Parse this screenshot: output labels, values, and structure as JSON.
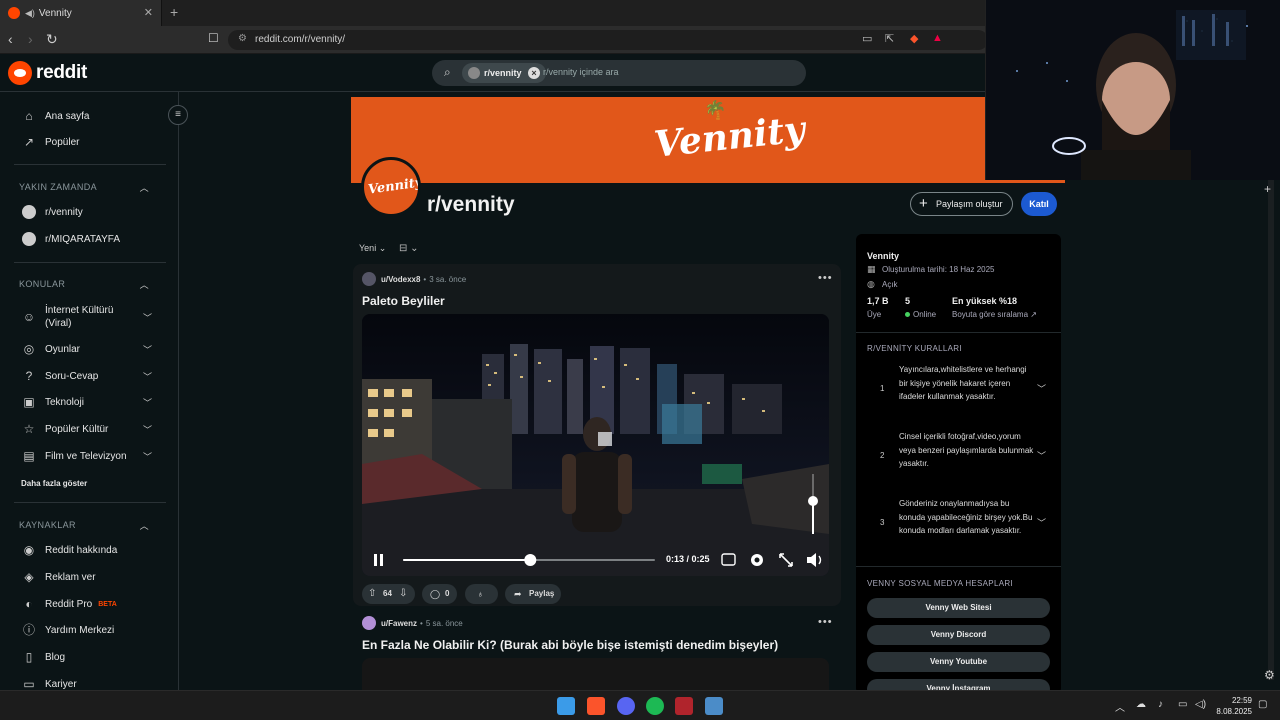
{
  "browser": {
    "tab_title": "Vennity",
    "url": "reddit.com/r/vennity/"
  },
  "header": {
    "logo_text": "reddit",
    "search_chip": "r/vennity",
    "search_placeholder": "r/vennity içinde ara"
  },
  "sidebar": {
    "top_items": [
      {
        "label": "Ana sayfa",
        "icon": "home-icon"
      },
      {
        "label": "Popüler",
        "icon": "popular-icon"
      }
    ],
    "recent_heading": "YAKIN ZAMANDA",
    "recent": [
      "r/vennity",
      "r/MIQARATAYFA"
    ],
    "topics_heading": "KONULAR",
    "topics": [
      {
        "label": "İnternet Kültürü (Viral)",
        "icon": "smile-icon"
      },
      {
        "label": "Oyunlar",
        "icon": "gamepad-icon"
      },
      {
        "label": "Soru-Cevap",
        "icon": "question-icon"
      },
      {
        "label": "Teknoloji",
        "icon": "chip-icon"
      },
      {
        "label": "Popüler Kültür",
        "icon": "star-icon"
      },
      {
        "label": "Film ve Televizyon",
        "icon": "film-icon"
      }
    ],
    "show_more": "Daha fazla göster",
    "resources_heading": "KAYNAKLAR",
    "resources": [
      {
        "label": "Reddit hakkında",
        "icon": "reddit-icon"
      },
      {
        "label": "Reklam ver",
        "icon": "megaphone-icon"
      },
      {
        "label": "Reddit Pro",
        "icon": "pro-icon"
      },
      {
        "label": "Yardım Merkezi",
        "icon": "help-icon"
      },
      {
        "label": "Blog",
        "icon": "book-icon"
      },
      {
        "label": "Kariyer",
        "icon": "briefcase-icon"
      }
    ],
    "beta_badge": "BETA"
  },
  "subreddit": {
    "banner_text": "Vennity",
    "avatar_text": "Vennity",
    "name": "r/vennity",
    "create_post": "Paylaşım oluştur",
    "join": "Katıl",
    "sort": "Yeni"
  },
  "posts": [
    {
      "user": "u/Vodexx8",
      "time": "3 sa. önce",
      "title": "Paleto Beyliler",
      "video_time": "0:13 / 0:25",
      "progress": 0.505,
      "volume": 0.55,
      "votes": "64",
      "comments": "0",
      "share": "Paylaş"
    },
    {
      "user": "u/Fawenz",
      "time": "5 sa. önce",
      "title": "En Fazla Ne Olabilir Ki? (Burak abi böyle bişe istemişti denedim bişeyler)"
    }
  ],
  "community": {
    "title": "Vennity",
    "created": "Oluşturulma tarihi: 18 Haz 2025",
    "visibility": "Açık",
    "members_value": "1,7 B",
    "members_label": "Üye",
    "online_value": "5",
    "online_label": "Online",
    "rank_value": "En yüksek %18",
    "rank_label": "Boyuta göre sıralama",
    "rules_heading": "R/VENNİTY KURALLARI",
    "rules": [
      {
        "num": "1",
        "text": "Yayıncılara,whitelistlere ve herhangi bir kişiye yönelik hakaret içeren ifadeler kullanmak yasaktır."
      },
      {
        "num": "2",
        "text": "Cinsel içerikli fotoğraf,video,yorum veya benzeri paylaşımlarda bulunmak yasaktır."
      },
      {
        "num": "3",
        "text": "Gönderiniz onaylanmadıysa bu konuda yapabileceğiniz birşey yok.Bu konuda modları darlamak yasaktır."
      }
    ],
    "social_heading": "VENNY SOSYAL MEDYA HESAPLARI",
    "social": [
      "Venny Web Sitesi",
      "Venny Discord",
      "Venny Youtube",
      "Venny İnstagram"
    ]
  },
  "taskbar": {
    "time": "22:59",
    "date": "8.08.2025"
  },
  "colors": {
    "accent": "#ff4500",
    "banner": "#e1571a",
    "join": "#1c5ad1",
    "background": "#0b1416"
  }
}
